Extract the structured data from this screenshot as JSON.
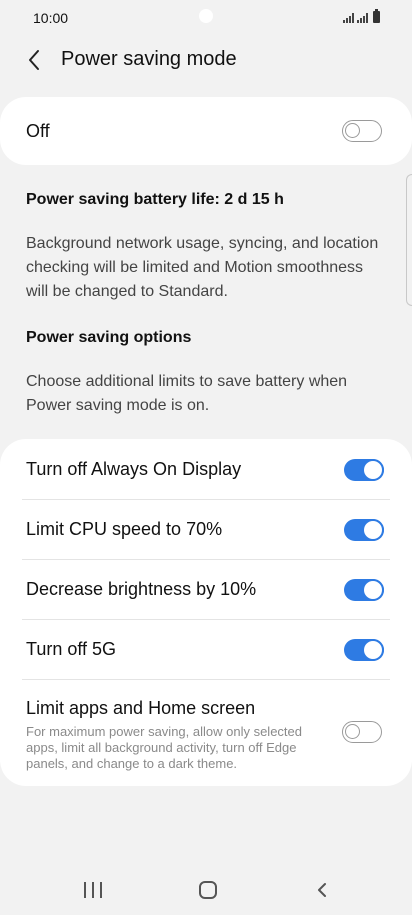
{
  "status_bar": {
    "time": "10:00"
  },
  "header": {
    "title": "Power saving mode"
  },
  "master_toggle": {
    "label": "Off",
    "enabled": false
  },
  "battery_life": {
    "text": "Power saving battery life: 2 d 15 h"
  },
  "description": "Background network usage, syncing, and location checking will be limited and Motion smoothness will be changed to Standard.",
  "options_section": {
    "title": "Power saving options",
    "description": "Choose additional limits to save battery when Power saving mode is on."
  },
  "options": [
    {
      "label": "Turn off Always On Display",
      "enabled": true
    },
    {
      "label": "Limit CPU speed to 70%",
      "enabled": true
    },
    {
      "label": "Decrease brightness by 10%",
      "enabled": true
    },
    {
      "label": "Turn off 5G",
      "enabled": true
    },
    {
      "label": "Limit apps and Home screen",
      "enabled": false,
      "description": "For maximum power saving, allow only selected apps, limit all background activity, turn off Edge panels, and change to a dark theme."
    }
  ],
  "colors": {
    "accent": "#2e7be3",
    "background": "#f2f2f2",
    "card": "#ffffff"
  },
  "icons": {
    "back": "chevron-left-icon",
    "nav_recents": "recents-icon",
    "nav_home": "home-icon",
    "nav_back": "back-icon"
  }
}
